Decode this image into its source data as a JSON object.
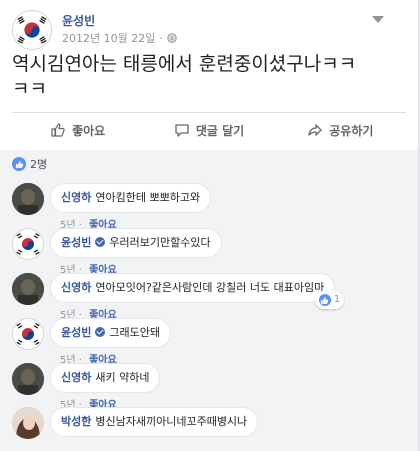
{
  "post": {
    "author": "윤성빈",
    "date": "2012년 10월 22일",
    "text_line1": "역시김연아는 태릉에서 훈련중이셨구나ㅋㅋ",
    "text_line2": "ㅋㅋ"
  },
  "actions": {
    "like": "좋아요",
    "comment": "댓글 달기",
    "share": "공유하기"
  },
  "reactions": {
    "count": "2명"
  },
  "comments": [
    {
      "name": "신영하",
      "text": "연아킴한테 뽀뽀하고와",
      "time": "5년",
      "like": "좋아요"
    },
    {
      "name": "윤성빈",
      "text": "우러러보기만할수있다",
      "time": "5년",
      "like": "좋아요"
    },
    {
      "name": "신영하",
      "text": "연아모잇어?같은사람인데 강칠러 너도 대표아임마",
      "time": "5년",
      "like": "좋아요",
      "reactions": "1"
    },
    {
      "name": "윤성빈",
      "text": "그래도안돼",
      "time": "5년",
      "like": "좋아요"
    },
    {
      "name": "신영하",
      "text": "새키 약하네",
      "time": "5년",
      "like": "좋아요"
    },
    {
      "name": "박성한",
      "text": "병신남자새끼아니네꼬주때병시나",
      "time": "5년",
      "like": "좋아요"
    }
  ],
  "colors": {
    "link": "#365899",
    "accent": "#4267b2",
    "like_blue": "#5890ff"
  },
  "icons": [
    "flag-avatar",
    "globe-icon",
    "chevron-down-icon",
    "thumbs-up-icon",
    "comment-icon",
    "share-icon",
    "verified-badge-icon"
  ]
}
